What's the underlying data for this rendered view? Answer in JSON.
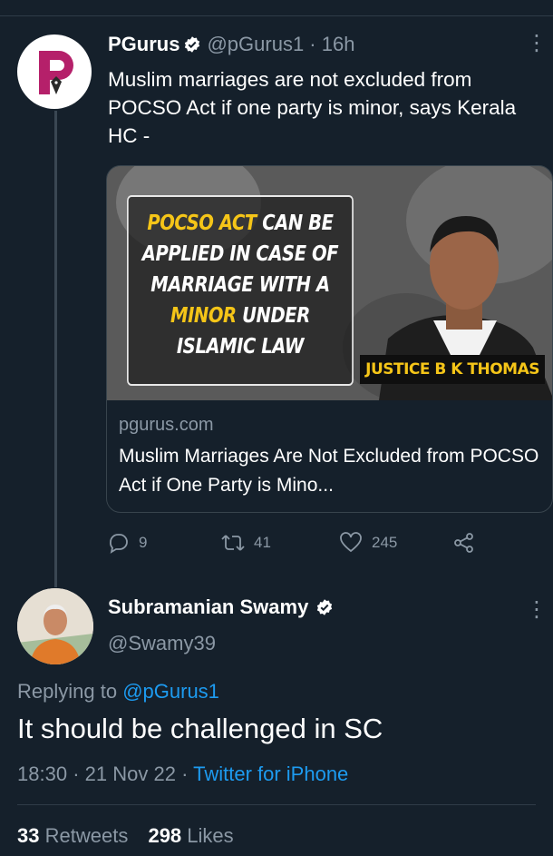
{
  "tweet1": {
    "name": "PGurus",
    "handle": "@pGurus1",
    "time": "16h",
    "text": "Muslim marriages are not excluded from POCSO Act if one party is minor, says Kerala HC -",
    "card": {
      "headline_parts": [
        {
          "text": "POCSO ACT",
          "highlight": true
        },
        {
          "text": " CAN BE APPLIED IN CASE OF MARRIAGE WITH A ",
          "highlight": false
        },
        {
          "text": "MINOR",
          "highlight": true
        },
        {
          "text": " UNDER ISLAMIC LAW",
          "highlight": false
        }
      ],
      "image_caption": "JUSTICE B K THOMAS",
      "domain": "pgurus.com",
      "title": "Muslim Marriages Are Not Excluded from POCSO Act if One Party is Mino..."
    },
    "actions": {
      "replies": "9",
      "retweets": "41",
      "likes": "245"
    }
  },
  "tweet2": {
    "name": "Subramanian Swamy",
    "handle": "@Swamy39",
    "replying_prefix": "Replying to",
    "replying_to": "@pGurus1",
    "text": "It should be challenged in SC",
    "time": "18:30",
    "date": "21 Nov 22",
    "source": "Twitter for iPhone",
    "retweets_count": "33",
    "retweets_label": "Retweets",
    "likes_count": "298",
    "likes_label": "Likes"
  },
  "colors": {
    "background": "#15202b",
    "muted": "#8b98a5",
    "link": "#1d9bf0",
    "highlight": "#f5c518",
    "brand_pgurus": "#b5206a"
  },
  "icons": [
    "verified-badge-icon",
    "more-icon",
    "reply-icon",
    "retweet-icon",
    "like-icon",
    "share-icon"
  ]
}
